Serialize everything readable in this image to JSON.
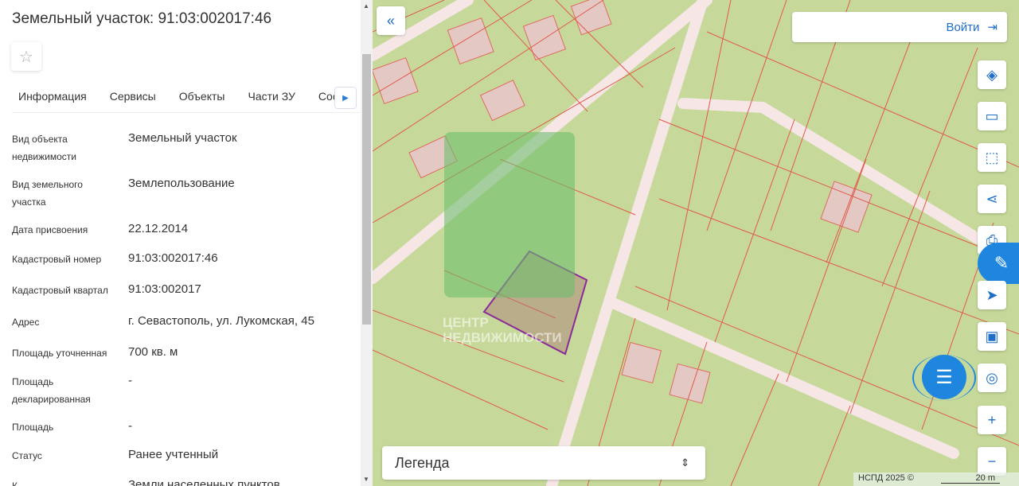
{
  "panel": {
    "title": "Земельный участок: 91:03:002017:46",
    "tabs": [
      "Информация",
      "Сервисы",
      "Объекты",
      "Части ЗУ",
      "Состав"
    ],
    "fields": [
      {
        "label": "Вид объекта недвижимости",
        "value": "Земельный участок"
      },
      {
        "label": "Вид земельного участка",
        "value": "Землепользование"
      },
      {
        "label": "Дата присвоения",
        "value": "22.12.2014"
      },
      {
        "label": "Кадастровый номер",
        "value": "91:03:002017:46"
      },
      {
        "label": "Кадастровый квартал",
        "value": "91:03:002017"
      },
      {
        "label": "Адрес",
        "value": "г. Севастополь, ул. Лукомская, 45"
      },
      {
        "label": "Площадь уточненная",
        "value": "700 кв. м"
      },
      {
        "label": "Площадь декларированная",
        "value": "-"
      },
      {
        "label": "Площадь",
        "value": "-"
      },
      {
        "label": "Статус",
        "value": "Ранее учтенный"
      },
      {
        "label": "К",
        "value": "Земли населенных пунктов"
      }
    ]
  },
  "map": {
    "login_label": "Войти",
    "legend_label": "Легенда",
    "attribution": "НСПД 2025 ©",
    "scale_label": "20 m",
    "watermark_text": "ЦЕНТР НЕДВИЖИМОСТИ",
    "accent": "#1e6fc8"
  }
}
